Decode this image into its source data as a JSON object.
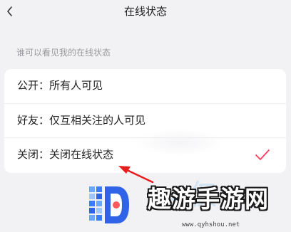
{
  "header": {
    "title": "在线状态",
    "back_icon": "chevron-left-icon"
  },
  "section": {
    "caption": "谁可以看见我的在线状态"
  },
  "options": [
    {
      "label": "公开：所有人可见",
      "selected": false
    },
    {
      "label": "好友：仅互相关注的人可见",
      "selected": false
    },
    {
      "label": "关闭：关闭在线状态",
      "selected": true
    }
  ],
  "colors": {
    "accent": "#ff3b5c",
    "background": "#f2f2f4",
    "card": "#ffffff",
    "caption": "#9a9a9e",
    "annotation_arrow": "#e61e1e"
  },
  "watermark": {
    "text": "趣游手游网",
    "url": "www.qyhshou.net"
  }
}
